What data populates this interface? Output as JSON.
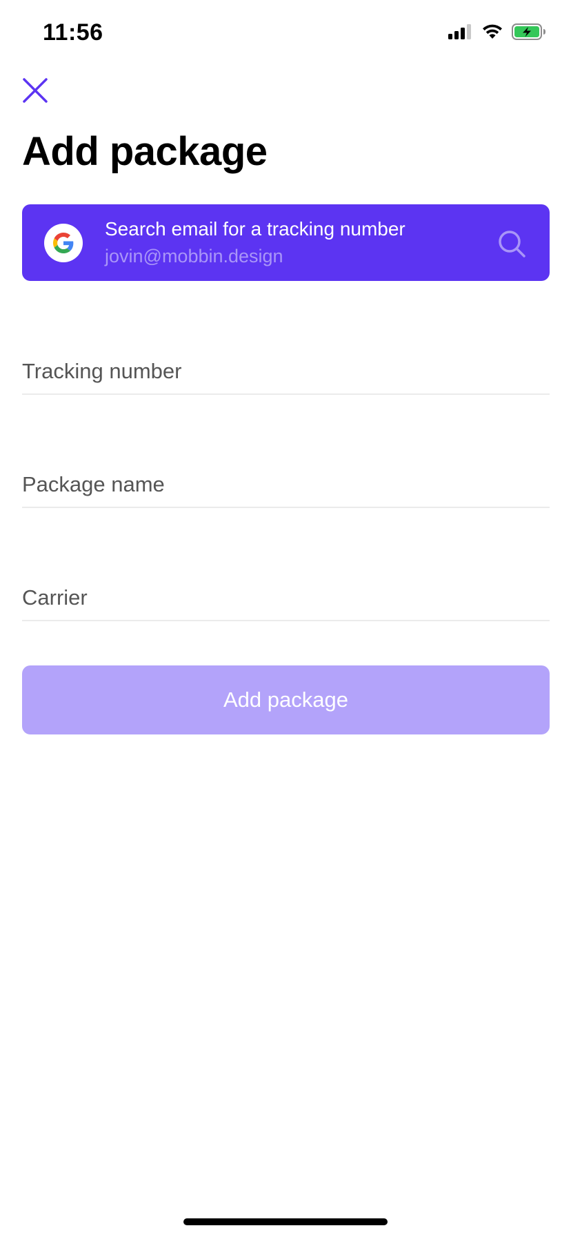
{
  "status_bar": {
    "time": "11:56",
    "icons": [
      "cellular-signal-icon",
      "wifi-icon",
      "battery-charging-icon"
    ]
  },
  "header": {
    "close_icon": "close-icon",
    "title": "Add package"
  },
  "email_search": {
    "provider_icon": "google-icon",
    "title": "Search email for a tracking number",
    "email": "jovin@mobbin.design",
    "search_icon": "search-icon"
  },
  "form": {
    "tracking_number": {
      "placeholder": "Tracking number",
      "value": ""
    },
    "package_name": {
      "placeholder": "Package name",
      "value": ""
    },
    "carrier": {
      "placeholder": "Carrier",
      "value": ""
    }
  },
  "submit": {
    "label": "Add package"
  },
  "colors": {
    "accent": "#5c34f2",
    "button_disabled": "#b3a3fa",
    "email_sub": "#a995f8",
    "battery": "#34c759"
  }
}
